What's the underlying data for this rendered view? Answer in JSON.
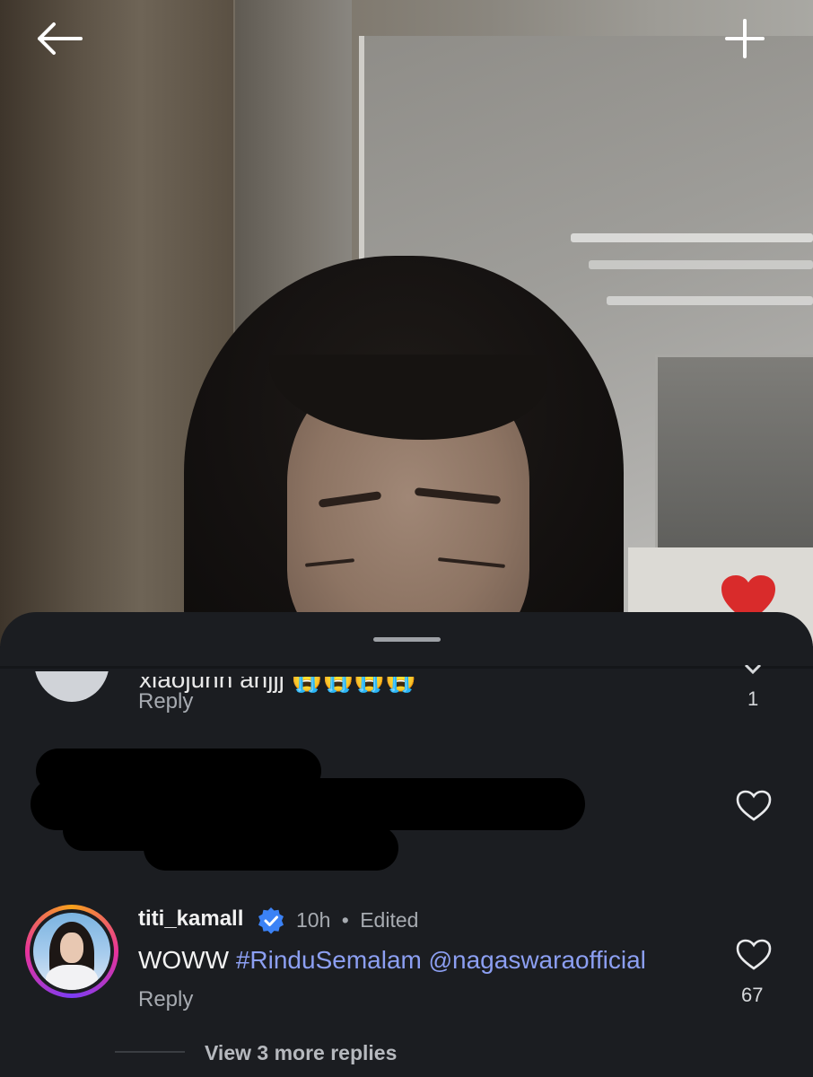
{
  "topbar": {
    "back_icon": "arrow-left-icon",
    "add_icon": "plus-icon"
  },
  "comments": [
    {
      "text_partial": "xiaojunn anjjj 😭😭😭😭",
      "reply_label": "Reply",
      "like_count": "1"
    },
    {
      "redacted": true
    },
    {
      "username": "titi_kamall",
      "verified": true,
      "time": "10h",
      "separator": "•",
      "edited": "Edited",
      "text_plain": "WOWW",
      "hashtag": "#RinduSemalam",
      "mention_prefix": "@",
      "mention": "nagaswaraofficial",
      "reply_label": "Reply",
      "like_count": "67",
      "view_more": "View 3 more replies"
    }
  ],
  "colors": {
    "sheet_bg": "#1b1d21",
    "link": "#8c9ff2",
    "like_heart": "#d92b2b",
    "verified": "#3b82f6"
  }
}
